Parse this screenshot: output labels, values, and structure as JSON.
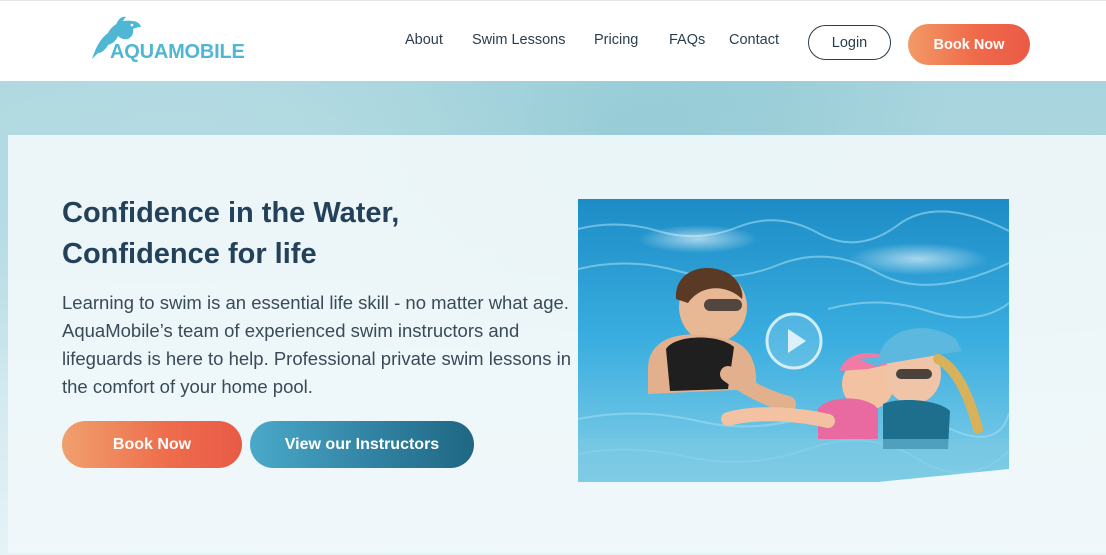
{
  "header": {
    "logo_text": "AQUAMOBILE",
    "nav": [
      {
        "label": "About"
      },
      {
        "label": "Swim Lessons"
      },
      {
        "label": "Pricing"
      },
      {
        "label": "FAQs"
      },
      {
        "label": "Contact"
      }
    ],
    "login_label": "Login",
    "book_label": "Book Now"
  },
  "hero": {
    "title_line1": "Confidence in the Water,",
    "title_line2": "Confidence for life",
    "description": "Learning to swim is an essential life skill - no matter what age. AquaMobile’s team of experienced swim instructors and lifeguards is here to help. Professional private swim lessons in the comfort of your home pool.",
    "book_label": "Book Now",
    "instructors_label": "View our Instructors"
  },
  "video": {
    "icon": "play-icon"
  },
  "colors": {
    "brand": "#4fb7d3",
    "navy": "#24415a",
    "orange": "#ee6c4b",
    "teal": "#2f7f9f"
  }
}
